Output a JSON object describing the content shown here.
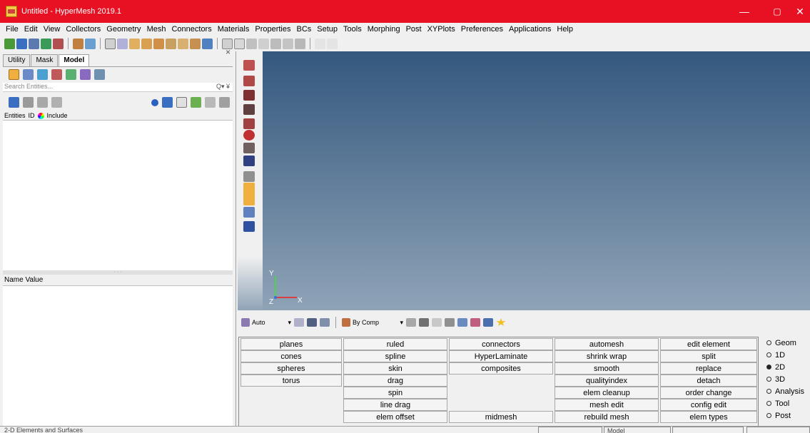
{
  "window": {
    "title": "Untitled - HyperMesh 2019.1",
    "minimize": "—",
    "maximize": "▢",
    "close": "✕"
  },
  "menu": [
    "File",
    "Edit",
    "View",
    "Collectors",
    "Geometry",
    "Mesh",
    "Connectors",
    "Materials",
    "Properties",
    "BCs",
    "Setup",
    "Tools",
    "Morphing",
    "Post",
    "XYPlots",
    "Preferences",
    "Applications",
    "Help"
  ],
  "browser": {
    "tabs": [
      "Utility",
      "Mask",
      "Model"
    ],
    "active_tab": "Model",
    "search_placeholder": "Search Entities...",
    "search_icons": "Q▾ ¥",
    "columns": {
      "entities": "Entities",
      "id": "ID",
      "include": "Include"
    },
    "name_value_header": "Name Value",
    "splitter_dots": "· · ·"
  },
  "viewport": {
    "axis_y": "Y",
    "axis_z": "Z",
    "axis_x": "X"
  },
  "bottom_toolbar": {
    "display_mode": "Auto",
    "color_mode": "By Comp"
  },
  "panel": {
    "col1": [
      "planes",
      "cones",
      "spheres",
      "torus"
    ],
    "col2": [
      "ruled",
      "spline",
      "skin",
      "drag",
      "spin",
      "line drag",
      "elem offset"
    ],
    "col3": [
      "connectors",
      "HyperLaminate",
      "composites",
      "midmesh"
    ],
    "col4": [
      "automesh",
      "shrink wrap",
      "smooth",
      "qualityindex",
      "elem cleanup",
      "mesh edit",
      "rebuild mesh"
    ],
    "col5": [
      "edit element",
      "split",
      "replace",
      "detach",
      "order change",
      "config edit",
      "elem types"
    ]
  },
  "page_radios": [
    {
      "label": "Geom",
      "selected": false
    },
    {
      "label": "1D",
      "selected": false
    },
    {
      "label": "2D",
      "selected": true
    },
    {
      "label": "3D",
      "selected": false
    },
    {
      "label": "Analysis",
      "selected": false
    },
    {
      "label": "Tool",
      "selected": false
    },
    {
      "label": "Post",
      "selected": false
    }
  ],
  "status": {
    "message": "2-D Elements and Surfaces",
    "model_label": "Model"
  },
  "colors": {
    "titlebar": "#e81123",
    "viewport_top": "#34587e",
    "viewport_bottom": "#8fa3b7"
  }
}
